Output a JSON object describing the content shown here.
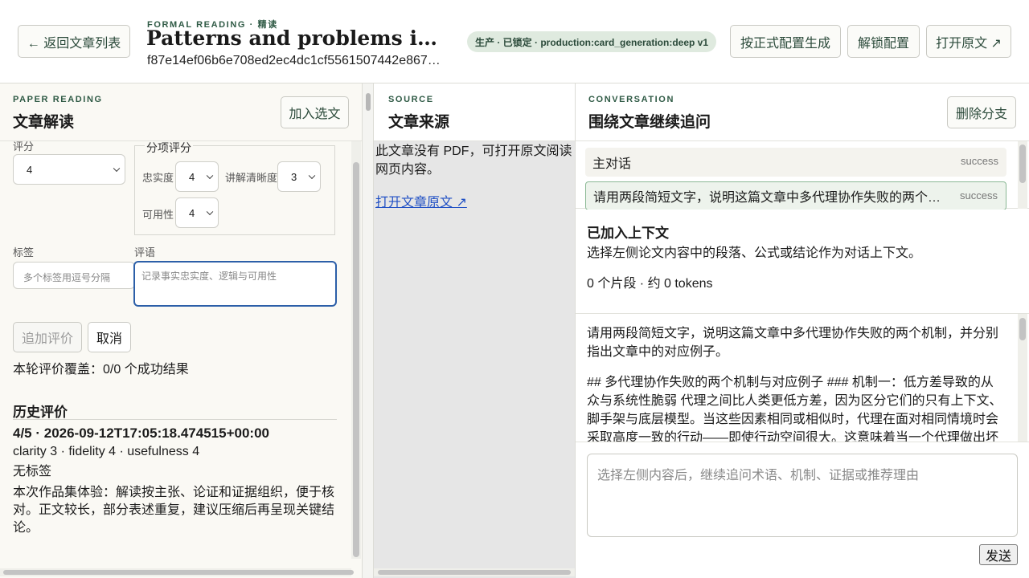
{
  "header": {
    "back_label": "← 返回文章列表",
    "eyebrow": "FORMAL READING · 精读",
    "title": "Patterns and problems in e…",
    "hash": "f87e14ef06b6e708ed2ec4dc1cf5561507442e867…",
    "status_badge": "生产 · 已锁定 · production:card_generation:deep v1",
    "generate_label": "按正式配置生成",
    "unlock_label": "解锁配置",
    "open_label": "打开原文 ↗"
  },
  "left": {
    "eyebrow": "PAPER READING",
    "title": "文章解读",
    "add_label": "加入选文",
    "score_label": "评分",
    "score_value": "4",
    "subscores_legend": "分项评分",
    "fidelity_label": "忠实度",
    "fidelity_value": "4",
    "clarity_label": "讲解清晰度",
    "clarity_value": "3",
    "usefulness_label": "可用性",
    "usefulness_value": "4",
    "tags_label": "标签",
    "tags_placeholder": "多个标签用逗号分隔",
    "comment_label": "评语",
    "comment_placeholder": "记录事实忠实度、逻辑与可用性",
    "append_label": "追加评价",
    "cancel_label": "取消",
    "coverage": "本轮评价覆盖：0/0 个成功结果",
    "history_title": "历史评价",
    "history_score": "4/5 · 2026-09-12T17:05:18.474515+00:00",
    "history_dims": "clarity 3 · fidelity 4 · usefulness 4",
    "history_tags": "无标签",
    "history_comment": "本次作品集体验：解读按主张、论证和证据组织，便于核对。正文较长，部分表述重复，建议压缩后再呈现关键结论。"
  },
  "middle": {
    "eyebrow": "SOURCE",
    "title": "文章来源",
    "notice": "此文章没有 PDF，可打开原文阅读网页内容。",
    "link_label": "打开文章原文 ↗"
  },
  "right": {
    "eyebrow": "CONVERSATION",
    "title": "围绕文章继续追问",
    "delete_label": "删除分支",
    "branches": [
      {
        "label": "主对话",
        "status": "success"
      },
      {
        "label": "请用两段简短文字，说明这篇文章中多代理协作失败的两个机制",
        "status": "success"
      }
    ],
    "context_title": "已加入上下文",
    "context_desc": "选择左侧论文内容中的段落、公式或结论作为对话上下文。",
    "context_count": "0 个片段 · 约 0 tokens",
    "question": "请用两段简短文字，说明这篇文章中多代理协作失败的两个机制，并分别指出文章中的对应例子。",
    "answer": "## 多代理协作失败的两个机制与对应例子 ### 机制一：低方差导致的从众与系统性脆弱 代理之间比人类更低方差，因为区分它们的只有上下文、脚手架与底层模型。当这些因素相同或相似时，代理在面对相同情境时会采取高度一致的行动——即使行动空间很大。这意味着当一个代理做出坏",
    "composer_placeholder": "选择左侧内容后，继续追问术语、机制、证据或推荐理由",
    "send_label": "发送"
  }
}
